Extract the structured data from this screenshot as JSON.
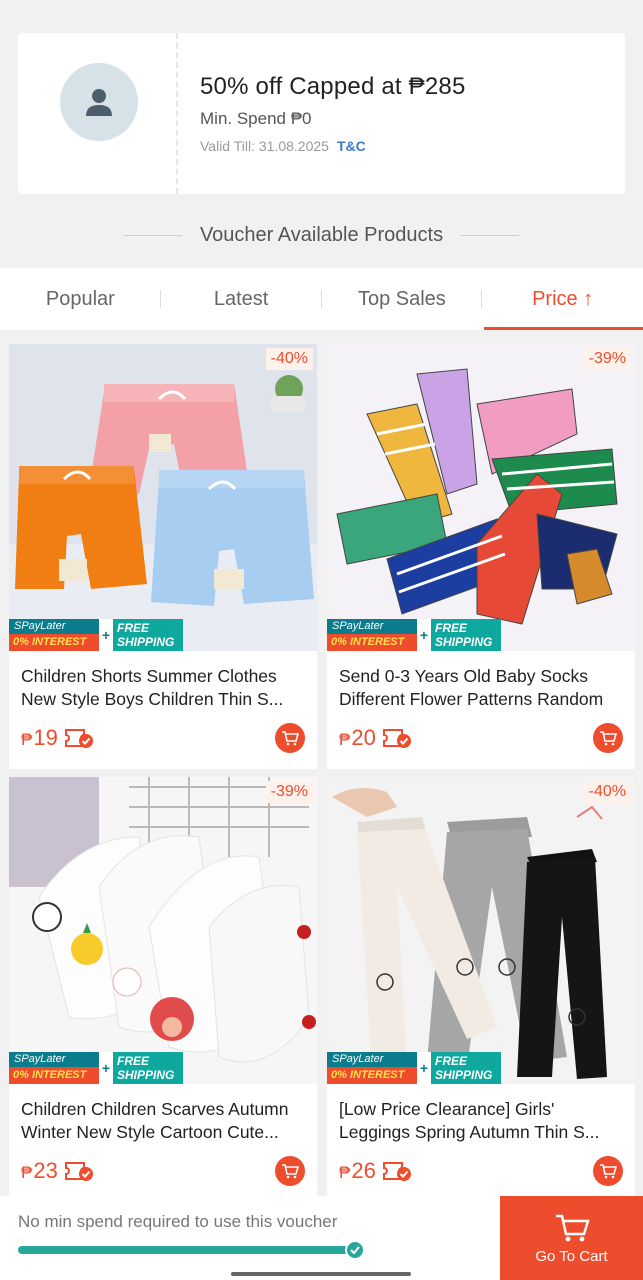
{
  "voucher": {
    "title": "50% off Capped at ₱285",
    "min_spend": "Min. Spend ₱0",
    "valid_till": "Valid Till: 31.08.2025",
    "tnc": "T&C"
  },
  "section_title": "Voucher Available Products",
  "tabs": [
    {
      "label": "Popular"
    },
    {
      "label": "Latest"
    },
    {
      "label": "Top Sales"
    },
    {
      "label": "Price ↑",
      "active": true
    }
  ],
  "badges": {
    "spaylater": "SPayLater",
    "interest": "0% INTEREST",
    "free": "FREE",
    "shipping": "SHIPPING"
  },
  "products": [
    {
      "discount": "-40%",
      "name_line1": "Children Shorts Summer Clothes",
      "name_line2": "New Style Boys Children Thin S...",
      "currency": "₱",
      "price": "19"
    },
    {
      "discount": "-39%",
      "name_line1": "Send 0-3 Years Old Baby Socks",
      "name_line2": "Different Flower Patterns Random",
      "currency": "₱",
      "price": "20"
    },
    {
      "discount": "-39%",
      "name_line1": "Children Children Scarves Autumn",
      "name_line2": "Winter New Style Cartoon Cute...",
      "currency": "₱",
      "price": "23"
    },
    {
      "discount": "-40%",
      "name_line1": "[Low Price Clearance] Girls'",
      "name_line2": "Leggings Spring Autumn Thin S...",
      "currency": "₱",
      "price": "26"
    }
  ],
  "bottom": {
    "message": "No min spend required to use this voucher",
    "progress": 1.0,
    "go_to_cart": "Go To Cart"
  },
  "colors": {
    "accent": "#ee4d2d",
    "teal": "#27a69a"
  }
}
